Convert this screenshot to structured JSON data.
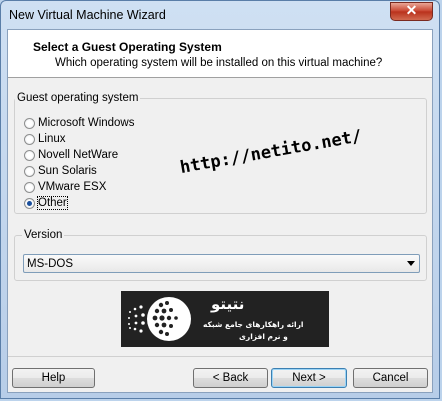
{
  "window": {
    "title": "New Virtual Machine Wizard",
    "close_glyph": "✕"
  },
  "header": {
    "title": "Select a Guest Operating System",
    "subtitle": "Which operating system will be installed on this virtual machine?"
  },
  "guest_os": {
    "group_label": "Guest operating system",
    "options": [
      {
        "label": "Microsoft Windows",
        "selected": false
      },
      {
        "label": "Linux",
        "selected": false
      },
      {
        "label": "Novell NetWare",
        "selected": false
      },
      {
        "label": "Sun Solaris",
        "selected": false
      },
      {
        "label": "VMware ESX",
        "selected": false
      },
      {
        "label": "Other",
        "selected": true
      }
    ]
  },
  "watermark": {
    "url": "http://netito.net/"
  },
  "version": {
    "label": "Version",
    "selected": "MS-DOS"
  },
  "banner": {
    "name": "نتیتو",
    "line1": "ارائه راهکارهای جامع شبکه",
    "line2": "و نرم افزاری"
  },
  "buttons": {
    "help": "Help",
    "back": "< Back",
    "next": "Next >",
    "cancel": "Cancel"
  },
  "colors": {
    "accent": "#3c7fb1",
    "banner_bg": "#222222"
  }
}
